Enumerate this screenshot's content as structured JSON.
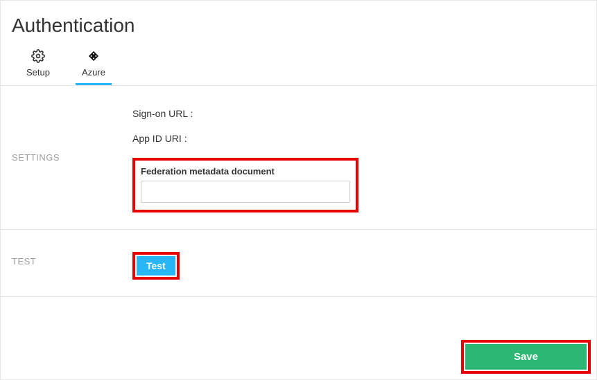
{
  "page": {
    "title": "Authentication"
  },
  "tabs": {
    "setup": {
      "label": "Setup"
    },
    "azure": {
      "label": "Azure"
    }
  },
  "sections": {
    "settings": {
      "heading": "SETTINGS",
      "sign_on_label": "Sign-on URL :",
      "app_id_label": "App ID URI :",
      "federation_label": "Federation metadata document",
      "federation_value": ""
    },
    "test": {
      "heading": "TEST",
      "button_label": "Test"
    }
  },
  "footer": {
    "save_label": "Save"
  },
  "icons": {
    "gear": "gear-icon",
    "diamond": "diamond-icon"
  }
}
